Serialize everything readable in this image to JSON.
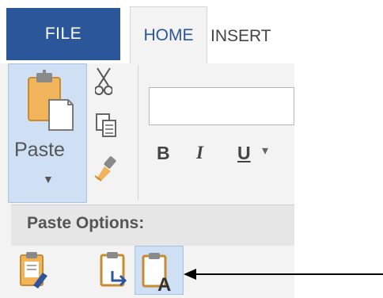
{
  "tabs": {
    "file": "FILE",
    "home": "HOME",
    "insert": "INSERT"
  },
  "clipboard": {
    "paste_label": "Paste",
    "paste_dropdown_icon": "chevron-down-icon",
    "cut_icon": "scissors-icon",
    "copy_icon": "copy-icon",
    "format_painter_icon": "format-painter-icon"
  },
  "font": {
    "bold": "B",
    "italic": "I",
    "underline": "U",
    "underline_dropdown": "▾"
  },
  "paste_options": {
    "title": "Paste Options:",
    "options": [
      {
        "icon": "keep-source-formatting-icon"
      },
      {
        "icon": "merge-formatting-icon"
      },
      {
        "icon": "keep-text-only-icon"
      }
    ]
  },
  "colors": {
    "file_tab": "#2b579a",
    "selected": "#cfe0f5",
    "ribbon_bg": "#f3f3f3",
    "clipboard_orange": "#f2b45b"
  }
}
